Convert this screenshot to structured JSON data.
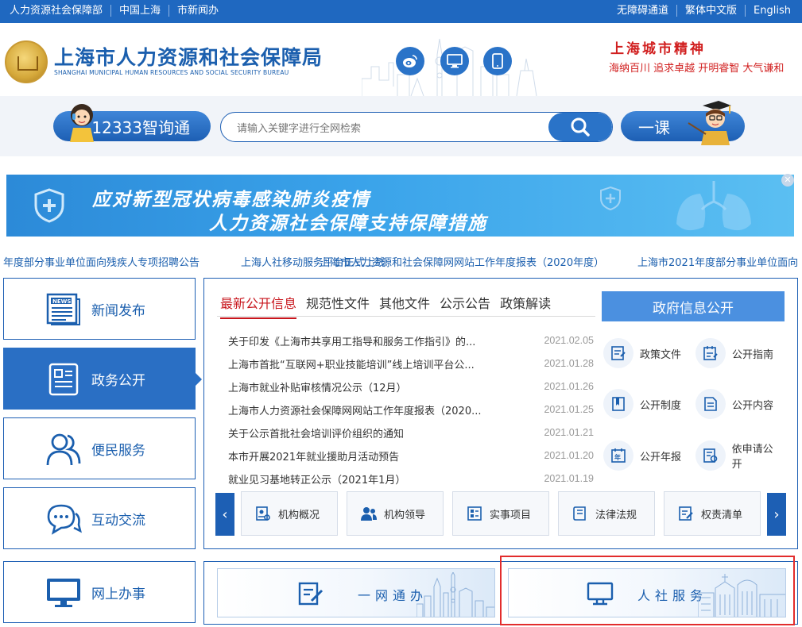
{
  "topbar": {
    "left": [
      "人力资源社会保障部",
      "中国上海",
      "市新闻办"
    ],
    "right": [
      "无障碍通道",
      "繁体中文版",
      "English"
    ]
  },
  "header": {
    "title": "上海市人力资源和社会保障局",
    "subtitle": "SHANGHAI MUNICIPAL HUMAN RESOURCES AND SOCIAL SECURITY BUREAU",
    "spirit_title": "上海城市精神",
    "spirit_sub": "海纳百川  追求卓越  开明睿智  大气谦和"
  },
  "search": {
    "hotline_label": "12333智询通",
    "placeholder": "请输入关键字进行全网检索",
    "course_label": "一课"
  },
  "banner": {
    "line1": "应对新型冠状病毒感染肺炎疫情",
    "line2": "人力资源社会保障支持保障措施",
    "close": "✕"
  },
  "ticker": [
    "年度部分事业单位面向残疾人专项招聘公告",
    "上海人社移动服务平台正式上线",
    "上海市人力资源和社会保障网网站工作年度报表（2020年度）",
    "上海市2021年度部分事业单位面向"
  ],
  "leftnav": [
    {
      "label": "新闻发布"
    },
    {
      "label": "政务公开"
    },
    {
      "label": "便民服务"
    },
    {
      "label": "互动交流"
    },
    {
      "label": "网上办事"
    }
  ],
  "tabs": [
    "最新公开信息",
    "规范性文件",
    "其他文件",
    "公示公告",
    "政策解读"
  ],
  "news": [
    {
      "title": "关于印发《上海市共享用工指导和服务工作指引》的...",
      "date": "2021.02.05"
    },
    {
      "title": "上海市首批“互联网+职业技能培训”线上培训平台公...",
      "date": "2021.01.28"
    },
    {
      "title": "上海市就业补贴审核情况公示（12月）",
      "date": "2021.01.26"
    },
    {
      "title": "上海市人力资源社会保障网网站工作年度报表（2020...",
      "date": "2021.01.25"
    },
    {
      "title": "关于公示首批社会培训评价组织的通知",
      "date": "2021.01.21"
    },
    {
      "title": "本市开展2021年就业援助月活动预告",
      "date": "2021.01.20"
    },
    {
      "title": "就业见习基地转正公示（2021年1月）",
      "date": "2021.01.19"
    }
  ],
  "gov": {
    "button": "政府信息公开",
    "items": [
      "政策文件",
      "公开指南",
      "公开制度",
      "公开内容",
      "公开年报",
      "依申请公开"
    ]
  },
  "carousel": {
    "prev": "‹",
    "next": "›",
    "cards": [
      "机构概况",
      "机构领导",
      "实事项目",
      "法律法规",
      "权责清单"
    ]
  },
  "services": [
    "一网通办",
    "人社服务"
  ]
}
